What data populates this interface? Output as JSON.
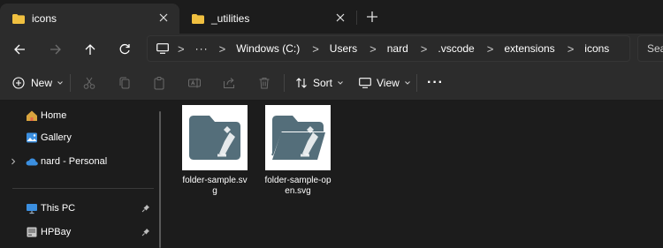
{
  "tabs": [
    {
      "label": "icons",
      "active": true
    },
    {
      "label": "_utilities",
      "active": false
    }
  ],
  "nav": {
    "back": "back-arrow",
    "forward": "forward-arrow",
    "up": "up-arrow",
    "refresh": "refresh"
  },
  "breadcrumb": {
    "more": "···",
    "separator": ">",
    "items": [
      "Windows (C:)",
      "Users",
      "nard",
      ".vscode",
      "extensions",
      "icons"
    ]
  },
  "search": {
    "placeholder": "Sea"
  },
  "toolbar": {
    "new_label": "New",
    "sort_label": "Sort",
    "view_label": "View",
    "more": "···"
  },
  "sidebar": {
    "items": [
      {
        "label": "Home"
      },
      {
        "label": "Gallery"
      },
      {
        "label": "nard - Personal"
      },
      {
        "label": "This PC"
      },
      {
        "label": "HPBay"
      }
    ]
  },
  "files": [
    {
      "name": "folder-sample.svg"
    },
    {
      "name": "folder-sample-open.svg"
    }
  ],
  "colors": {
    "folder_yellow": "#f0c040",
    "icon_slate": "#546e7a",
    "onedrive_blue": "#3b8fe0",
    "bg": "#1c1c1c",
    "toolbar_bg": "#2c2c2c"
  }
}
